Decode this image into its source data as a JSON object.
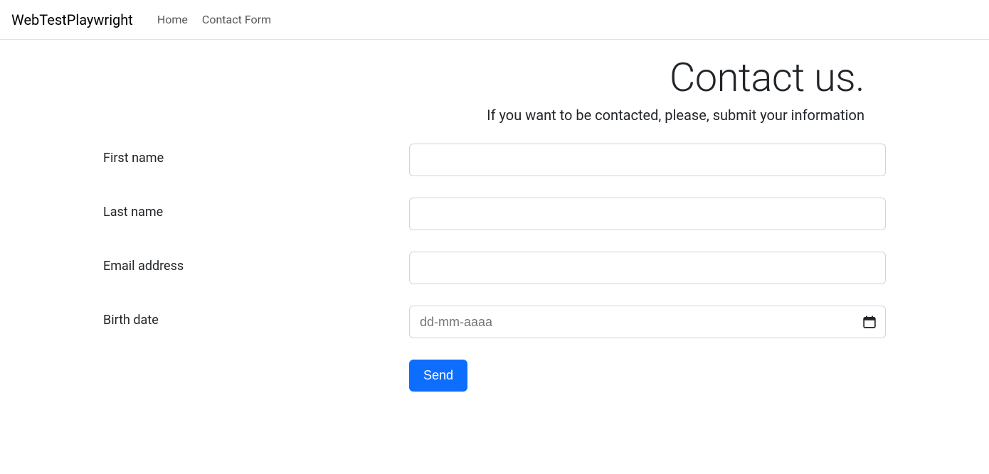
{
  "navbar": {
    "brand": "WebTestPlaywright",
    "links": [
      {
        "label": "Home"
      },
      {
        "label": "Contact Form"
      }
    ]
  },
  "page": {
    "title": "Contact us.",
    "subtitle": "If you want to be contacted, please, submit your information"
  },
  "form": {
    "first_name": {
      "label": "First name",
      "value": ""
    },
    "last_name": {
      "label": "Last name",
      "value": ""
    },
    "email": {
      "label": "Email address",
      "value": ""
    },
    "birth_date": {
      "label": "Birth date",
      "placeholder": "dd-mm-aaaa",
      "value": ""
    },
    "submit_label": "Send"
  }
}
